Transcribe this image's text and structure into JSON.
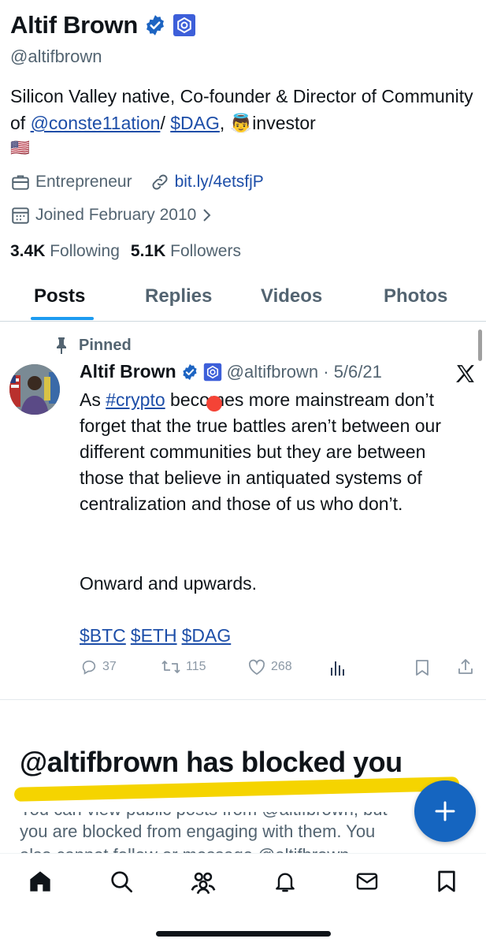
{
  "profile": {
    "name": "Altif Brown",
    "handle": "@altifbrown",
    "bio_part1": "Silicon Valley native, Co-founder & Director of Community of ",
    "bio_link1": "@conste11ation",
    "bio_part2": "/ ",
    "bio_link2": "$DAG",
    "bio_part3": ", ",
    "bio_emoji": "👼",
    "bio_part4": "investor",
    "bio_flag": "🇺🇸",
    "profession": "Entrepreneur",
    "website": "bit.ly/4etsfjP",
    "joined": "Joined February 2010",
    "following_count": "3.4K",
    "following_label": "Following",
    "followers_count": "5.1K",
    "followers_label": "Followers"
  },
  "tabs": [
    "Posts",
    "Replies",
    "Videos",
    "Photos"
  ],
  "post": {
    "pinned_label": "Pinned",
    "author": "Altif Brown",
    "handle_date": "@altifbrown · 5/6/21",
    "text_intro": "As ",
    "text_hashtag": "#crypto",
    "text_body": " becomes more mainstream don’t forget that the true battles aren’t between our different communities but they are between those that believe in antiquated systems of centralization and those of us who don’t.",
    "text_second": "Onward and upwards.",
    "cashtags": [
      "$BTC",
      "$ETH",
      "$DAG"
    ],
    "replies": "37",
    "reposts": "115",
    "likes": "268"
  },
  "blocked": {
    "title": "@altifbrown has blocked you",
    "line1": "You can view public posts from @altifbrown, but",
    "line2": "you are blocked from engaging with them. You",
    "line3": "also cannot follow or message @altifbrown."
  },
  "colors": {
    "accent": "#1d9bf0",
    "link": "#1d4ea8",
    "highlight": "#f5d400",
    "verified": "#1d64c2",
    "fab": "#1565c0"
  },
  "icons": {
    "verified": "verified-badge-icon",
    "affiliate": "constellation-affiliate-icon",
    "briefcase": "briefcase-icon",
    "link": "link-icon",
    "calendar": "calendar-icon",
    "pin": "pin-icon",
    "x_logo": "x-logo-icon"
  }
}
